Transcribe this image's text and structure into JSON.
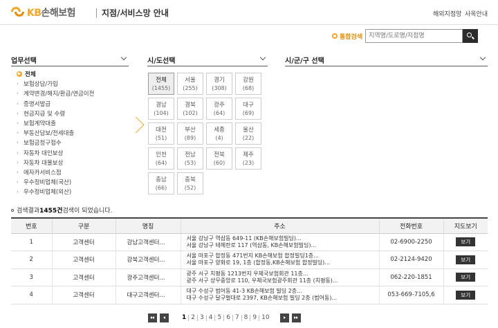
{
  "header": {
    "logo_kb": "KB",
    "logo_text": "손해보험",
    "title": "지점/서비스망 안내",
    "links": [
      "해외지점망",
      "사옥안내"
    ]
  },
  "search": {
    "label": "통합검색",
    "placeholder": "지역명/도로명/지점명",
    "button_icon": "search-icon"
  },
  "panels": {
    "business": "업무선택",
    "region": "시/도선택",
    "district": "시/군/구 선택"
  },
  "business_items": [
    "전체",
    "보험상담/가입",
    "계약변경/해지/환급/연금이전",
    "증명서발급",
    "현금지급 및 수령",
    "보험계약대출",
    "부동산담보/전세대출",
    "보험금청구접수",
    "자동차 대인보상",
    "자동차 대물보상",
    "애자카서비스점",
    "우수정비업체(국산)",
    "우수정비업체(외산)"
  ],
  "regions": [
    {
      "name": "전체",
      "count": "(1455)"
    },
    {
      "name": "서울",
      "count": "(255)"
    },
    {
      "name": "경기",
      "count": "(308)"
    },
    {
      "name": "강원",
      "count": "(68)"
    },
    {
      "name": "경남",
      "count": "(104)"
    },
    {
      "name": "경북",
      "count": "(102)"
    },
    {
      "name": "광주",
      "count": "(64)"
    },
    {
      "name": "대구",
      "count": "(69)"
    },
    {
      "name": "대전",
      "count": "(51)"
    },
    {
      "name": "부산",
      "count": "(89)"
    },
    {
      "name": "세종",
      "count": "(4)"
    },
    {
      "name": "울산",
      "count": "(22)"
    },
    {
      "name": "인천",
      "count": "(64)"
    },
    {
      "name": "전남",
      "count": "(53)"
    },
    {
      "name": "전북",
      "count": "(60)"
    },
    {
      "name": "제주",
      "count": "(23)"
    },
    {
      "name": "충남",
      "count": "(66)"
    },
    {
      "name": "충북",
      "count": "(52)"
    }
  ],
  "result": {
    "prefix": "검색결과 ",
    "count": "1455건",
    "suffix": " 검색이 되었습니다."
  },
  "table": {
    "headers": [
      "번호",
      "구분",
      "명칭",
      "주소",
      "전화번호",
      "지도보기"
    ],
    "rows": [
      {
        "no": "1",
        "type": "고객센터",
        "name": "강남고객센터...",
        "addr1": "서울 강남구 역삼동 649-11 (KB손해보험빌딩)...",
        "addr2": "서울 강남구 테헤란로 117 (역삼동, KB손해보험빌딩)...",
        "phone": "02-6900-2250",
        "btn": "보기"
      },
      {
        "no": "2",
        "type": "고객센터",
        "name": "강북고객센터...",
        "addr1": "서울 마포구 합정동 471번지 KB손해보험 합정빌딩1층...",
        "addr2": "서울 마포구 양화로 19, 1층 (합정동,KB손해보험 합정빌딩)...",
        "phone": "02-2124-9420",
        "btn": "보기"
      },
      {
        "no": "3",
        "type": "고객센터",
        "name": "광주고객센터...",
        "addr1": "광주 서구 치평동 1213번지 우체국보험회관 11층...",
        "addr2": "광주 서구 상무중앙로 110, 우체국보험광주회관 11층 (치평동)...",
        "phone": "062-220-1851",
        "btn": "보기"
      },
      {
        "no": "4",
        "type": "고객센터",
        "name": "대구고객센터...",
        "addr1": "대구 수성구 범어동 41-3 KB손해보험 빌딩 2층...",
        "addr2": "대구 수성구 달구벌대로 2397, KB손해보험 빌딩 2층 (범어동)...",
        "phone": "053-669-7105,6",
        "btn": "보기"
      }
    ]
  },
  "pager": {
    "pages": [
      "1",
      "2",
      "3",
      "4",
      "5",
      "6",
      "7",
      "8",
      "9",
      "10"
    ],
    "current": "1"
  }
}
